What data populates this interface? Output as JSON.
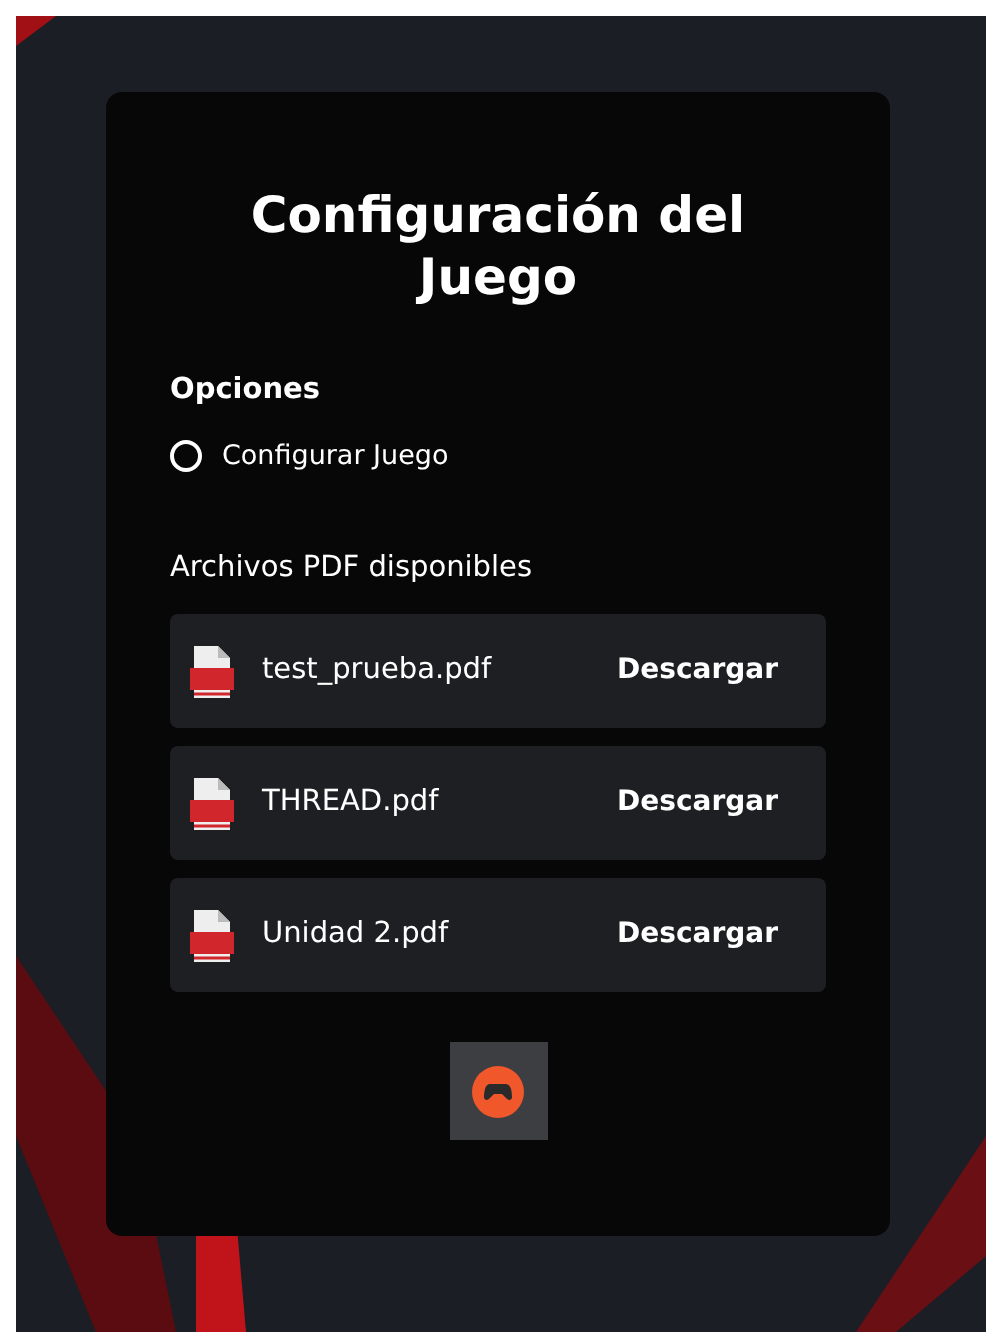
{
  "title": "Configuración del Juego",
  "options": {
    "heading": "Opciones",
    "items": [
      {
        "label": "Configurar Juego",
        "selected": false
      }
    ]
  },
  "files": {
    "heading": "Archivos PDF disponibles",
    "items": [
      {
        "name": "test_prueba.pdf",
        "action": "Descargar"
      },
      {
        "name": "THREAD.pdf",
        "action": "Descargar"
      },
      {
        "name": "Unidad 2.pdf",
        "action": "Descargar"
      }
    ]
  }
}
